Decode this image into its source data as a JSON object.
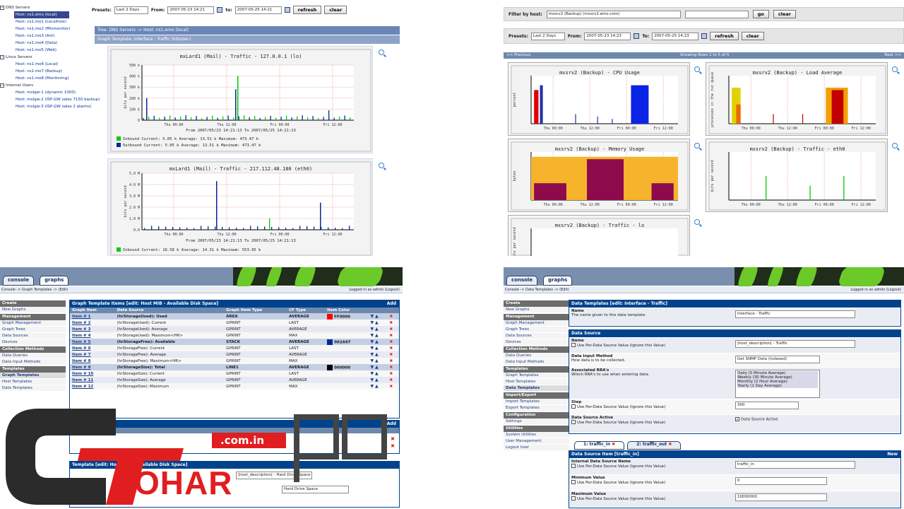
{
  "q1": {
    "tree": [
      {
        "type": "node",
        "label": "DNS Servers"
      },
      {
        "type": "sel",
        "label": "Host: ns1.emo (local)"
      },
      {
        "type": "leaf",
        "label": "Host: ns1.mo1 (Localhost)"
      },
      {
        "type": "leaf",
        "label": "Host: ns1.mo2 (Mtsmonitor)"
      },
      {
        "type": "leaf",
        "label": "Host: ns1.mo3 (Ant)"
      },
      {
        "type": "leaf",
        "label": "Host: ns1.mo4 (Data)"
      },
      {
        "type": "leaf",
        "label": "Host: ns1.mo5 (Web)"
      },
      {
        "type": "node",
        "label": "Linux Servers"
      },
      {
        "type": "leaf",
        "label": "Host: ns1.mo6 (Local)"
      },
      {
        "type": "leaf",
        "label": "Host: ns1.mo7 (Backup)"
      },
      {
        "type": "leaf",
        "label": "Host: ns1.mo8 (Monitoring)"
      },
      {
        "type": "node",
        "label": "Internet Users"
      },
      {
        "type": "leaf",
        "label": "Host: mxlgw-1 (dynamic 1000)"
      },
      {
        "type": "leaf",
        "label": "Host: mxlgw-2 (ISP-GW sales 7150 backup)"
      },
      {
        "type": "leaf",
        "label": "Host: mxlgw-3 (ISP-GW sales 2 alarms)"
      }
    ],
    "presets_label": "Presets:",
    "preset_value": "Last 2 Days",
    "from_label": "From:",
    "from_value": "2007-05-23 14:21",
    "to_label": "to:",
    "to_value": "2007-05-25 14:21",
    "refresh": "refresh",
    "clear": "clear",
    "tree_path": "Tree: DNS Servers -> Host: ns1.emo (local)",
    "graph_template": "Graph Template: Interface - Traffic (bits/sec)",
    "graph1": {
      "title": "mxLard1 (Mail) - Traffic - 127.0.0.1 (lo)",
      "ylabel": "bits per second",
      "yticks": [
        "500 k",
        "400 k",
        "300 k",
        "200 k",
        "100 k",
        "0"
      ],
      "xticks": [
        "Thu 00:00",
        "Thu 12:00",
        "Fri 00:00",
        "Fri 12:00"
      ],
      "from_to": "From 2007/05/23 14:21:13 To 2007/05/25 14:21:13",
      "legend": [
        {
          "name": "Inbound",
          "cur": "5.05 k",
          "avg": "13.51 k",
          "max": "473.47 k",
          "color": "#00cc00"
        },
        {
          "name": "Outbound",
          "cur": "5.05 k",
          "avg": "13.51 k",
          "max": "473.47 k",
          "color": "#002a97"
        }
      ],
      "labels": {
        "current": "Current:",
        "average": "Average:",
        "maximum": "Maximum:"
      }
    },
    "graph2": {
      "title": "mxLard1 (Mail) - Traffic - 217.112.48.180 (eth0)",
      "ylabel": "bits per second",
      "yticks": [
        "5.0 M",
        "4.0 M",
        "3.0 M",
        "2.0 M",
        "1.0 M",
        "0.0"
      ],
      "xticks": [
        "Thu 00:00",
        "Thu 12:00",
        "Fri 00:00",
        "Fri 12:00"
      ],
      "from_to": "From 2007/05/23 14:21:13 To 2007/05/25 14:21:13",
      "legend": [
        {
          "name": "Inbound",
          "cur": "16.58 k",
          "avg": "14.31 k",
          "max": "553.95 k",
          "color": "#00cc00"
        }
      ]
    }
  },
  "q2": {
    "filter_label": "Filter by host:",
    "filter_value": "mxsrv2 (Backup) (mxsrv2.emo.com)",
    "go": "go",
    "clear": "clear",
    "presets_label": "Presets:",
    "preset_value": "Last 2 Days",
    "from_label": "From:",
    "from_value": "2007-05-23 14:23",
    "to_label": "To:",
    "to_value": "2007-05-25 14:23",
    "refresh": "refresh",
    "prev": "<< Previous",
    "showing": "Showing Rows 1 to 5 of 5",
    "next": "Next >>",
    "graphs": [
      {
        "title": "mxsrv2 (Backup) - CPU Usage",
        "ylabel": "percent",
        "xticks": [
          "Thu 00:00",
          "Thu 12:00",
          "Fri 00:00",
          "Fri 12:00"
        ]
      },
      {
        "title": "mxsrv2 (Backup) - Load Average",
        "ylabel": "processes in the run queue",
        "xticks": [
          "Thu 00:00",
          "Thu 12:00",
          "Fri 00:00",
          "Fri 12:00"
        ]
      },
      {
        "title": "mxsrv2 (Backup) - Memory Usage",
        "ylabel": "bytes",
        "xticks": [
          "Thu 00:00",
          "Thu 12:00",
          "Fri 00:00",
          "Fri 12:00"
        ]
      },
      {
        "title": "mxsrv2 (Backup) - Traffic - eth0",
        "ylabel": "bits per second",
        "xticks": [
          "Thu 00:00",
          "Thu 12:00",
          "Fri 00:00",
          "Fri 12:00"
        ]
      },
      {
        "title": "mxsrv2 (Backup) - Traffic - lo",
        "ylabel": "bits per second",
        "xticks": []
      }
    ]
  },
  "q3": {
    "tabs": [
      "console",
      "graphs"
    ],
    "crumb": "Console -> Graph Templates -> (Edit)",
    "logged": "Logged in as admin (Logout)",
    "menu": [
      {
        "t": "h",
        "l": "Create"
      },
      {
        "t": "i",
        "l": "New Graphs"
      },
      {
        "t": "h",
        "l": "Management"
      },
      {
        "t": "i",
        "l": "Graph Management"
      },
      {
        "t": "i",
        "l": "Graph Trees"
      },
      {
        "t": "i",
        "l": "Data Sources"
      },
      {
        "t": "i",
        "l": "Devices"
      },
      {
        "t": "h",
        "l": "Collection Methods"
      },
      {
        "t": "i",
        "l": "Data Queries"
      },
      {
        "t": "i",
        "l": "Data Input Methods"
      },
      {
        "t": "h",
        "l": "Templates"
      },
      {
        "t": "i",
        "l": "Graph Templates",
        "cur": true
      },
      {
        "t": "i",
        "l": "Host Templates"
      },
      {
        "t": "i",
        "l": "Data Templates"
      }
    ],
    "items_title": "Graph Template Items [edit: Host MIB - Available Disk Space]",
    "add": "Add",
    "cols": [
      "Graph Item",
      "Data Source",
      "Graph Item Type",
      "CF Type",
      "Item Color"
    ],
    "rows": [
      {
        "item": "Item # 1",
        "ds": "(hrStorageUsed): Used",
        "type": "AREA",
        "cf": "AVERAGE",
        "color": "#FF0000",
        "hex": "FF0000",
        "hl": true
      },
      {
        "item": "Item # 2",
        "ds": "(hrStorageUsed): Current",
        "type": "GPRINT",
        "cf": "LAST",
        "color": "",
        "hex": ""
      },
      {
        "item": "Item # 3",
        "ds": "(hrStorageUsed): Average",
        "type": "GPRINT",
        "cf": "AVERAGE",
        "color": "",
        "hex": ""
      },
      {
        "item": "Item # 4",
        "ds": "(hrStorageUsed): Maximum<HR>",
        "type": "GPRINT",
        "cf": "MAX",
        "color": "",
        "hex": ""
      },
      {
        "item": "Item # 5",
        "ds": "(hrStorageFree): Available",
        "type": "STACK",
        "cf": "AVERAGE",
        "color": "#002A97",
        "hex": "002A97",
        "hl": true
      },
      {
        "item": "Item # 6",
        "ds": "(hrStorageFree): Current",
        "type": "GPRINT",
        "cf": "LAST",
        "color": "",
        "hex": ""
      },
      {
        "item": "Item # 7",
        "ds": "(hrStorageFree): Average",
        "type": "GPRINT",
        "cf": "AVERAGE",
        "color": "",
        "hex": ""
      },
      {
        "item": "Item # 8",
        "ds": "(hrStorageFree): Maximum<HR>",
        "type": "GPRINT",
        "cf": "MAX",
        "color": "",
        "hex": ""
      },
      {
        "item": "Item # 9",
        "ds": "(hrStorageSize): Total",
        "type": "LINE1",
        "cf": "AVERAGE",
        "color": "#000000",
        "hex": "000000",
        "hl": true
      },
      {
        "item": "Item # 10",
        "ds": "(hrStorageSize): Current",
        "type": "GPRINT",
        "cf": "LAST",
        "color": "",
        "hex": ""
      },
      {
        "item": "Item # 11",
        "ds": "(hrStorageSize): Average",
        "type": "GPRINT",
        "cf": "AVERAGE",
        "color": "",
        "hex": ""
      },
      {
        "item": "Item # 12",
        "ds": "(hrStorageSize): Maximum",
        "type": "GPRINT",
        "cf": "MAX",
        "color": "",
        "hex": ""
      }
    ],
    "inputs_title": "Graph Item Inputs",
    "name_col": "Name",
    "template_title": "Template [edit: Host MIB - Available Disk Space]",
    "title_label": "Title",
    "title_value": "|host_description| - Hard Drive Space",
    "title_value2": "Hard Drive Space"
  },
  "q4": {
    "tabs": [
      "console",
      "graphs"
    ],
    "crumb": "Console -> Data Templates -> (Edit)",
    "logged": "Logged in as admin (Logout)",
    "menu": [
      {
        "t": "h",
        "l": "Create"
      },
      {
        "t": "i",
        "l": "New Graphs"
      },
      {
        "t": "h",
        "l": "Management"
      },
      {
        "t": "i",
        "l": "Graph Management"
      },
      {
        "t": "i",
        "l": "Graph Trees"
      },
      {
        "t": "i",
        "l": "Data Sources"
      },
      {
        "t": "i",
        "l": "Devices"
      },
      {
        "t": "h",
        "l": "Collection Methods"
      },
      {
        "t": "i",
        "l": "Data Queries"
      },
      {
        "t": "i",
        "l": "Data Input Methods"
      },
      {
        "t": "h",
        "l": "Templates"
      },
      {
        "t": "i",
        "l": "Graph Templates"
      },
      {
        "t": "i",
        "l": "Host Templates"
      },
      {
        "t": "i",
        "l": "Data Templates",
        "cur": true
      },
      {
        "t": "h",
        "l": "Import/Export"
      },
      {
        "t": "i",
        "l": "Import Templates"
      },
      {
        "t": "i",
        "l": "Export Templates"
      },
      {
        "t": "h",
        "l": "Configuration"
      },
      {
        "t": "i",
        "l": "Settings"
      },
      {
        "t": "h",
        "l": "Utilities"
      },
      {
        "t": "i",
        "l": "System Utilities"
      },
      {
        "t": "i",
        "l": "User Management"
      },
      {
        "t": "i",
        "l": "Logout User"
      }
    ],
    "dt_title": "Data Templates [edit: Interface - Traffic]",
    "name_label": "Name",
    "name_desc": "The name given to this data template.",
    "name_value": "Interface - Traffic",
    "ds_title": "Data Source",
    "fields": [
      {
        "label": "Name",
        "desc": "Use Per-Data Source Value (Ignore this Value)",
        "value": "|host_description| - Traffic"
      },
      {
        "label": "Data Input Method",
        "desc": "How data is to be collected.",
        "value": "Get SNMP Data (Indexed)"
      },
      {
        "label": "Associated RRA's",
        "desc": "Which RRA's to use when entering data.",
        "list": [
          "Daily (5 Minute Average)",
          "Weekly (30 Minute Average)",
          "Monthly (2 Hour Average)",
          "Yearly (1 Day Average)"
        ]
      },
      {
        "label": "Step",
        "desc": "Use Per-Data Source Value (Ignore this Value)",
        "value": "300"
      },
      {
        "label": "Data Source Active",
        "desc": "Use Per-Data Source Value (Ignore this Value)",
        "value": "Data Source Active"
      }
    ],
    "subtabs": [
      "1: traffic_in",
      "2: traffic_out"
    ],
    "dsi_title": "Data Source Item [traffic_in]",
    "new": "New",
    "items": [
      {
        "label": "Internal Data Source Name",
        "desc": "Use Per-Data Source Value (Ignore this Value)",
        "value": "traffic_in"
      },
      {
        "label": "Minimum Value",
        "desc": "Use Per-Data Source Value (Ignore this Value)",
        "value": "0"
      },
      {
        "label": "Maximum Value",
        "desc": "Use Per-Data Source Value (Ignore this Value)",
        "value": "10000000"
      }
    ]
  },
  "watermark": {
    "com": ".com.in",
    "brand": "OHAR",
    "pc": "PC"
  }
}
